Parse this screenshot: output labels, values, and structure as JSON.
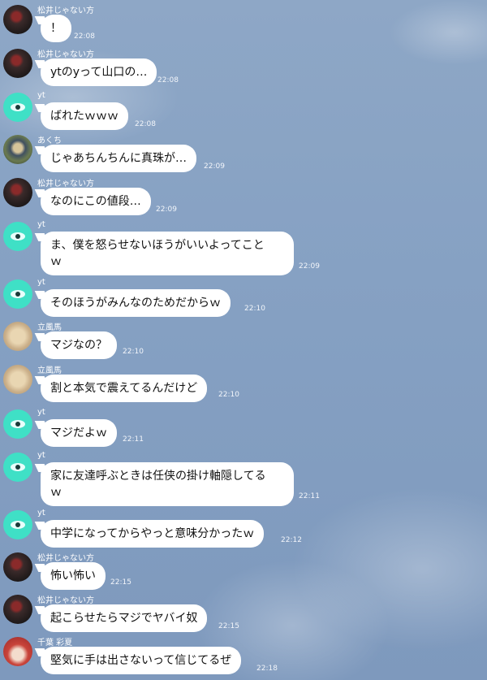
{
  "messages": [
    {
      "sender": "松井じゃない方",
      "avatar": "dark",
      "text": "！",
      "time": "22:08"
    },
    {
      "sender": "松井じゃない方",
      "avatar": "dark",
      "text": "ytのyって山口の…",
      "time": "22:08"
    },
    {
      "sender": "yt",
      "avatar": "cyan",
      "text": "ばれたｗｗｗ",
      "time": "22:08"
    },
    {
      "sender": "あくち",
      "avatar": "photo",
      "text": "じゃあちんちんに真珠が…",
      "time": "22:09"
    },
    {
      "sender": "松井じゃない方",
      "avatar": "dark",
      "text": "なのにこの値段…",
      "time": "22:09"
    },
    {
      "sender": "yt",
      "avatar": "cyan",
      "text_lines": [
        "ま、僕を怒らせないほうがいいよってこと",
        "ｗ"
      ],
      "time": "22:09"
    },
    {
      "sender": "yt",
      "avatar": "cyan",
      "text": "そのほうがみんなのためだからｗ",
      "time": "22:10"
    },
    {
      "sender": "立風馬",
      "avatar": "beige",
      "text": "マジなの？",
      "time": "22:10"
    },
    {
      "sender": "立風馬",
      "avatar": "beige",
      "text": "割と本気で震えてるんだけど",
      "time": "22:10"
    },
    {
      "sender": "yt",
      "avatar": "cyan",
      "text": "マジだよｗ",
      "time": "22:11"
    },
    {
      "sender": "yt",
      "avatar": "cyan",
      "text_lines": [
        "家に友達呼ぶときは任侠の掛け軸隠してる",
        "ｗ"
      ],
      "time": "22:11"
    },
    {
      "sender": "yt",
      "avatar": "cyan",
      "text": "中学になってからやっと意味分かったｗ",
      "time": "22:12"
    },
    {
      "sender": "松井じゃない方",
      "avatar": "dark",
      "text": "怖い怖い",
      "time": "22:15"
    },
    {
      "sender": "松井じゃない方",
      "avatar": "dark",
      "text": "起こらせたらマジでヤバイ奴",
      "time": "22:15"
    },
    {
      "sender": "千葉 彩夏",
      "avatar": "red",
      "text": "堅気に手は出さないって信じてるぜ",
      "time": "22:18"
    }
  ],
  "colors": {
    "background": "#86a1c3",
    "bubble": "#ffffff",
    "bubble_text": "#111111",
    "meta_text": "#ffffff"
  }
}
